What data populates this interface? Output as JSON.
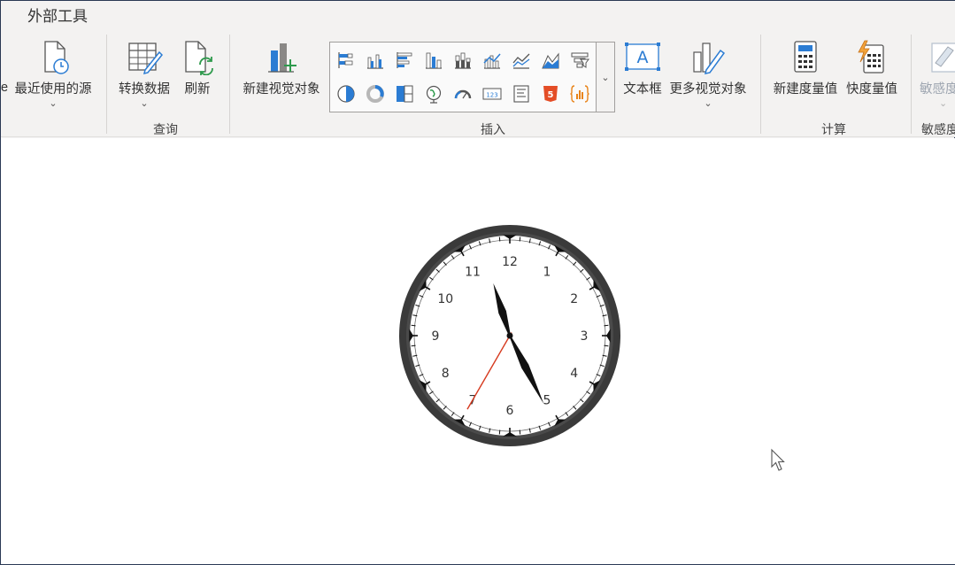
{
  "ribbon": {
    "title": "外部工具",
    "truncated_left": "e",
    "buttons": {
      "recent_sources": "最近使用的源",
      "transform_data": "转换数据",
      "refresh": "刷新",
      "new_visual": "新建视觉对象",
      "textbox": "文本框",
      "more_visuals": "更多视觉对象",
      "new_measure": "新建度量值",
      "quick_measure": "快度量值",
      "sensitivity": "敏感度"
    },
    "groups": {
      "query": "查询",
      "insert": "插入",
      "calculations": "计算",
      "sensitivity": "敏感度"
    },
    "chevron": "⌄"
  },
  "clock": {
    "numbers": [
      "12",
      "1",
      "2",
      "3",
      "4",
      "5",
      "6",
      "7",
      "8",
      "9",
      "10",
      "11"
    ],
    "time": {
      "hour": 11,
      "minute": 25,
      "second": 35
    },
    "colors": {
      "bezel": "#3a3a3a",
      "face": "#ffffff",
      "hands": "#111111",
      "second_hand": "#d63a1f"
    }
  },
  "icons": {
    "gallery_row1": [
      "stacked-bar-icon",
      "clustered-column-icon",
      "clustered-bar-icon",
      "column-icon",
      "stacked-column-icon",
      "line-column-icon",
      "line-chart-icon",
      "area-chart-icon",
      "funnel-icon"
    ],
    "gallery_row2": [
      "pie-chart-icon",
      "donut-chart-icon",
      "treemap-icon",
      "map-icon",
      "gauge-icon",
      "card-icon",
      "table-icon",
      "html5-icon",
      "custom-visual-icon"
    ]
  }
}
